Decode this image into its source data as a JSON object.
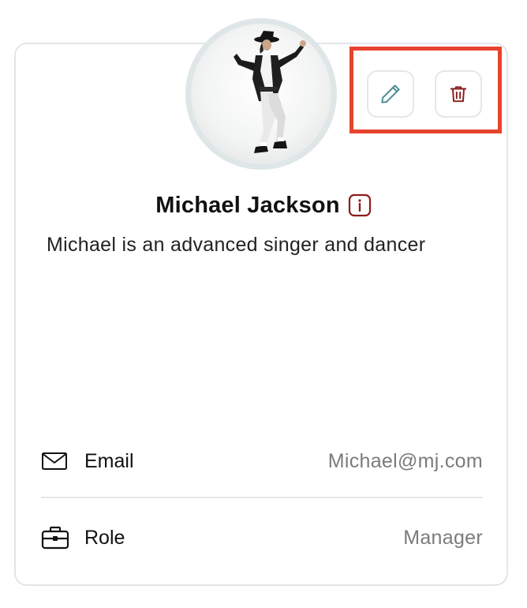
{
  "profile": {
    "name": "Michael Jackson",
    "description": "Michael is an advanced singer and dancer",
    "avatar_icon": "dancer-photo"
  },
  "actions": {
    "edit_icon": "pencil-icon",
    "delete_icon": "trash-icon"
  },
  "fields": {
    "email": {
      "label": "Email",
      "value": "Michael@mj.com",
      "icon": "mail-icon"
    },
    "role": {
      "label": "Role",
      "value": "Manager",
      "icon": "briefcase-icon"
    }
  },
  "colors": {
    "highlight": "#e8432e",
    "edit_icon": "#4f8f95",
    "delete_icon": "#8b1c1c",
    "info_icon": "#8b1c1c"
  }
}
